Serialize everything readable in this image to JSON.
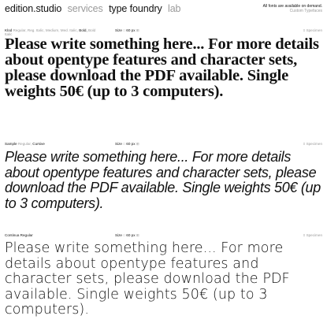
{
  "nav": {
    "brand": "edition.studio",
    "services": "services",
    "type_foundry": "type foundry",
    "lab": "lab"
  },
  "notice": {
    "line1": "All fonts are available on demand.",
    "line2": "Custom Typefaces"
  },
  "specimens": [
    {
      "font": "Klod",
      "styles": [
        "Regular,",
        "Reg. Italic,",
        "Medium,",
        "Med. Italic,",
        "Bold,",
        "Bold Italic"
      ],
      "selected_index": 4,
      "size_label": "Size",
      "size_minus": "□",
      "size_value": "60 px",
      "size_plus": "⊞",
      "action": "≡ Specimen",
      "text": "Please write something here... For more details about opentype features and character sets, please download the PDF available. Single weights 50€ (up to 3 computers)."
    },
    {
      "font": "Sample",
      "styles": [
        "Regular,",
        "Cursive"
      ],
      "selected_index": 1,
      "size_label": "Size",
      "size_minus": "□",
      "size_value": "60 px",
      "size_plus": "⊞",
      "action": "≡ Specimen",
      "text": "Please write something here... For more details about opentype features and character sets, please download the PDF available. Single weights 50€ (up to 3 computers)."
    },
    {
      "font": "Continua Regular",
      "styles": [],
      "selected_index": -1,
      "size_label": "Size",
      "size_minus": "□",
      "size_value": "60 px",
      "size_plus": "⊞",
      "action": "≡ Specimen",
      "text": "Please write something here... For more details about opentype features and character sets, please download the PDF available. Single weights 50€ (up to 3 computers)."
    }
  ]
}
